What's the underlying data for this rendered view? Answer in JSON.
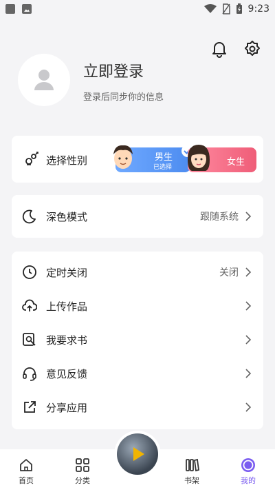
{
  "status_bar": {
    "time": "9:23"
  },
  "profile": {
    "login_title": "立即登录",
    "login_subtitle": "登录后同步你的信息"
  },
  "gender": {
    "label": "选择性别",
    "male_label": "男生",
    "male_selected_text": "已选择",
    "female_label": "女生"
  },
  "dark_mode": {
    "label": "深色模式",
    "value": "跟随系统"
  },
  "menu": [
    {
      "label": "定时关闭",
      "value": "关闭",
      "icon": "clock-icon"
    },
    {
      "label": "上传作品",
      "value": "",
      "icon": "cloud-upload-icon"
    },
    {
      "label": "我要求书",
      "value": "",
      "icon": "book-search-icon"
    },
    {
      "label": "意见反馈",
      "value": "",
      "icon": "headset-icon"
    },
    {
      "label": "分享应用",
      "value": "",
      "icon": "share-icon"
    }
  ],
  "tabbar": {
    "tabs": [
      {
        "label": "首页",
        "icon": "home-icon"
      },
      {
        "label": "分类",
        "icon": "grid-icon"
      },
      {
        "label": "书架",
        "icon": "bookshelf-icon"
      },
      {
        "label": "我的",
        "icon": "smile-icon",
        "active": true
      }
    ]
  },
  "colors": {
    "accent": "#7a5cf0",
    "male": "#4d8cf0",
    "female": "#ef5d78"
  }
}
